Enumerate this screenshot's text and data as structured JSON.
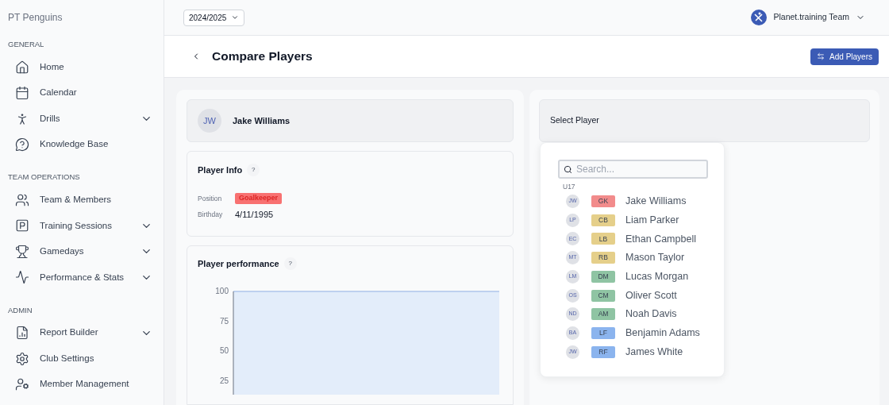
{
  "sidebar": {
    "club": "PT Penguins",
    "sections": [
      {
        "title": "GENERAL",
        "items": [
          {
            "label": "Home",
            "expandable": false
          },
          {
            "label": "Calendar",
            "expandable": false
          },
          {
            "label": "Drills",
            "expandable": true
          },
          {
            "label": "Knowledge Base",
            "expandable": false
          }
        ]
      },
      {
        "title": "TEAM OPERATIONS",
        "items": [
          {
            "label": "Team & Members",
            "expandable": false
          },
          {
            "label": "Training Sessions",
            "expandable": true
          },
          {
            "label": "Gamedays",
            "expandable": true
          },
          {
            "label": "Performance & Stats",
            "expandable": true
          }
        ]
      },
      {
        "title": "ADMIN",
        "items": [
          {
            "label": "Report Builder",
            "expandable": true
          },
          {
            "label": "Club Settings",
            "expandable": false
          },
          {
            "label": "Member Management",
            "expandable": false
          }
        ]
      }
    ]
  },
  "topbar": {
    "season": "2024/2025",
    "team": "Planet.training Team"
  },
  "header": {
    "title": "Compare Players",
    "action": "Add Players"
  },
  "left_panel": {
    "player": {
      "initials": "JW",
      "name": "Jake Williams"
    },
    "player_info": {
      "title": "Player Info",
      "help": "?",
      "fields": [
        {
          "label": "Position",
          "value": "Goalkeeper",
          "kind": "tag",
          "color": "#f87171"
        },
        {
          "label": "Birthday",
          "value": "4/11/1995",
          "kind": "text"
        }
      ]
    },
    "performance": {
      "title": "Player performance",
      "help": "?",
      "y_axis_labels": [
        "100",
        "75",
        "50",
        "25"
      ]
    }
  },
  "right_panel": {
    "select_label": "Select Player",
    "dropdown": {
      "search_placeholder": "Search...",
      "group": "U17",
      "players": [
        {
          "initials": "JW",
          "position": "GK",
          "name": "Jake Williams",
          "color": "#f28b8b"
        },
        {
          "initials": "LP",
          "position": "CB",
          "name": "Liam Parker",
          "color": "#e5cf8a"
        },
        {
          "initials": "EC",
          "position": "LB",
          "name": "Ethan Campbell",
          "color": "#e5cf8a"
        },
        {
          "initials": "MT",
          "position": "RB",
          "name": "Mason Taylor",
          "color": "#e5cf8a"
        },
        {
          "initials": "LM",
          "position": "DM",
          "name": "Lucas Morgan",
          "color": "#8fc4a3"
        },
        {
          "initials": "OS",
          "position": "CM",
          "name": "Oliver Scott",
          "color": "#8fc4a3"
        },
        {
          "initials": "ND",
          "position": "AM",
          "name": "Noah Davis",
          "color": "#8fc4a3"
        },
        {
          "initials": "BA",
          "position": "LF",
          "name": "Benjamin Adams",
          "color": "#8bb4ee"
        },
        {
          "initials": "JW",
          "position": "RF",
          "name": "James White",
          "color": "#8bb4ee"
        }
      ]
    }
  }
}
